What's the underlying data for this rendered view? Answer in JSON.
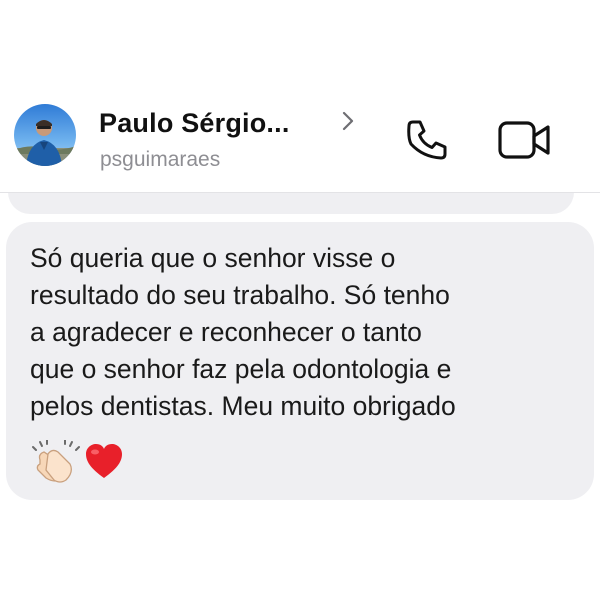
{
  "header": {
    "contact_name": "Paulo Sérgio...",
    "contact_handle": "psguimaraes",
    "icons": {
      "avatar": "avatar-photo",
      "disclosure": "chevron-right-icon",
      "call": "phone-icon",
      "video": "video-camera-icon"
    }
  },
  "message": {
    "lines": [
      "Só queria que o senhor visse o",
      "resultado do seu trabalho. Só tenho",
      "a agradecer e reconhecer o tanto",
      "que o senhor faz pela odontologia e",
      "pelos dentistas. Meu muito obrigado"
    ],
    "emojis": [
      "👏🏻",
      "❤️"
    ]
  },
  "colors": {
    "bubble_background": "#efeff2",
    "text": "#1a1a1a",
    "handle_text": "#8e8e93",
    "heart": "#e8202a"
  }
}
